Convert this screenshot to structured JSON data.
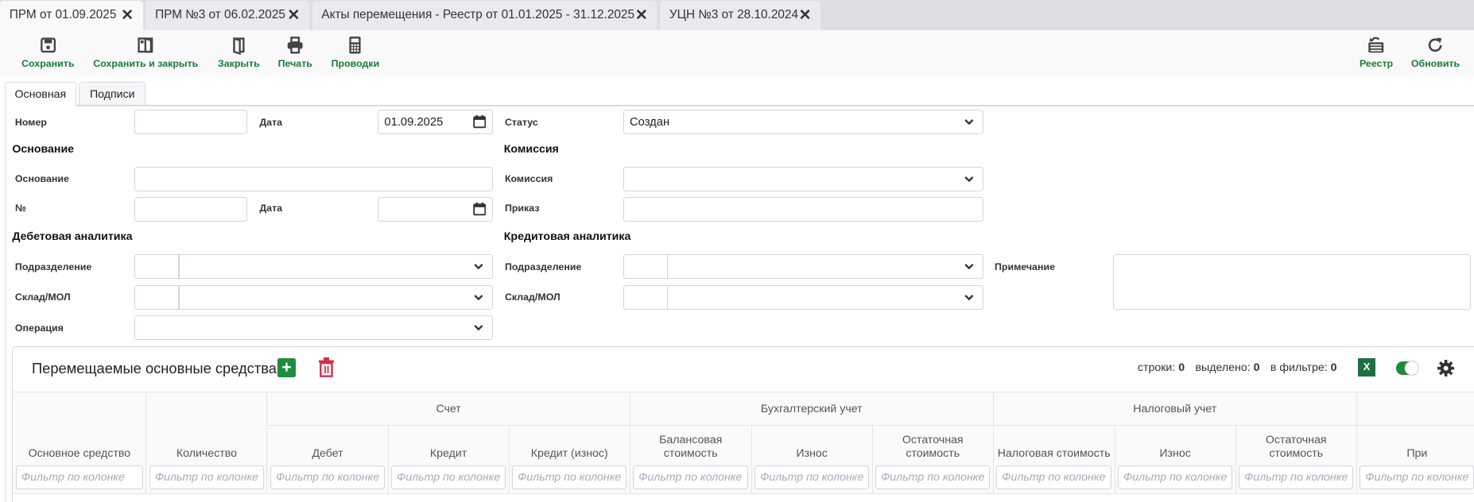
{
  "doc_tabs": [
    {
      "label": "ПРМ от 01.09.2025",
      "active": true
    },
    {
      "label": "ПРМ №3 от 06.02.2025",
      "active": false
    },
    {
      "label": "Акты перемещения - Реестр от 01.01.2025 - 31.12.2025",
      "active": false
    },
    {
      "label": "УЦН №3 от 28.10.2024",
      "active": false
    }
  ],
  "toolbar": {
    "save": "Сохранить",
    "save_close": "Сохранить и закрыть",
    "close": "Закрыть",
    "print": "Печать",
    "postings": "Проводки",
    "registry": "Реестр",
    "refresh": "Обновить"
  },
  "form_tabs": [
    "Основная",
    "Подписи"
  ],
  "form": {
    "number_label": "Номер",
    "number_value": "",
    "date_label": "Дата",
    "date_value": "01.09.2025",
    "status_label": "Статус",
    "status_value": "Создан",
    "basis_heading": "Основание",
    "commission_heading": "Комиссия",
    "basis_label": "Основание",
    "basis_value": "",
    "commission_label": "Комиссия",
    "commission_value": "",
    "basis_no_label": "№",
    "basis_no_value": "",
    "basis_date_label": "Дата",
    "basis_date_value": "",
    "order_label": "Приказ",
    "order_value": "",
    "debit_heading": "Дебетовая аналитика",
    "credit_heading": "Кредитовая аналитика",
    "dept_label": "Подразделение",
    "warehouse_label": "Склад/МОЛ",
    "credit_dept_label": "Подразделение",
    "credit_warehouse_label": "Склад/МОЛ",
    "note_label": "Примечание",
    "note_value": "",
    "operation_label": "Операция",
    "operation_value": ""
  },
  "table": {
    "title": "Перемещаемые основные средства",
    "rows_label": "строки:",
    "rows": "0",
    "selected_label": "выделено:",
    "selected": "0",
    "filtered_label": "в фильтре:",
    "filtered": "0",
    "excel_label": "X",
    "toggle_on": true,
    "groups": {
      "account": "Счет",
      "accounting": "Бухгалтерский учет",
      "tax": "Налоговый учет"
    },
    "columns": [
      {
        "label": "Основное средство",
        "filter": "Фильтр по колонке"
      },
      {
        "label": "Количество",
        "filter": "Фильтр по колонке"
      },
      {
        "label": "Дебет",
        "filter": "Фильтр по колонке"
      },
      {
        "label": "Кредит",
        "filter": "Фильтр по колонке"
      },
      {
        "label": "Кредит (износ)",
        "filter": "Фильтр по колонке"
      },
      {
        "label": "Балансовая стоимость",
        "filter": "Фильтр по колонке"
      },
      {
        "label": "Износ",
        "filter": "Фильтр по колонке"
      },
      {
        "label": "Остаточная стоимость",
        "filter": "Фильтр по колонке"
      },
      {
        "label": "Налоговая стоимость",
        "filter": "Фильтр по колонке"
      },
      {
        "label": "Износ",
        "filter": "Фильтр по колонке"
      },
      {
        "label": "Остаточная стоимость",
        "filter": "Фильтр по колонке"
      },
      {
        "label": "При",
        "filter": "Фильтр по колонке"
      }
    ]
  },
  "colors": {
    "accent_green": "#1b7a3a",
    "add_green": "#1e8b3f",
    "delete_red": "#d9294a",
    "excel_green": "#1d6f42"
  }
}
